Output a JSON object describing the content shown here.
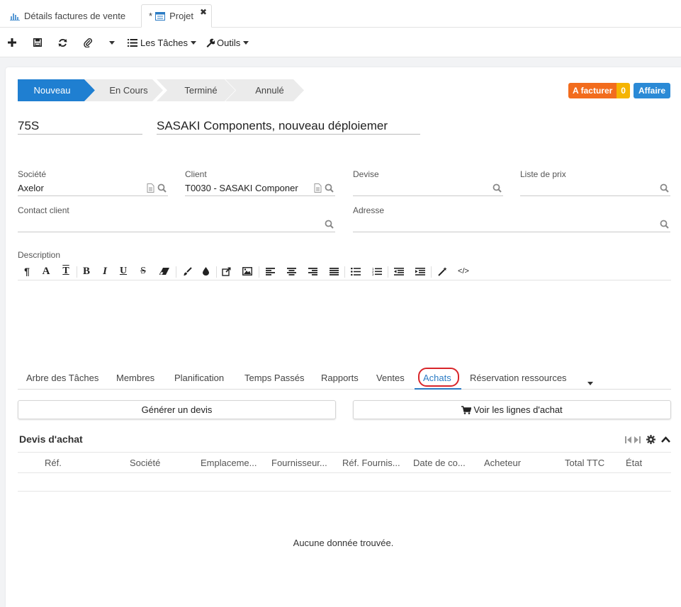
{
  "tabs": [
    {
      "label": "Détails factures de vente"
    },
    {
      "label": "* Projet",
      "close": "×"
    }
  ],
  "toolbar": {
    "tasks_label": "Les Tâches",
    "tools_label": "Outils"
  },
  "status_steps": [
    {
      "label": "Nouveau",
      "active": true
    },
    {
      "label": "En Cours",
      "active": false
    },
    {
      "label": "Terminé",
      "active": false
    },
    {
      "label": "Annulé",
      "active": false
    }
  ],
  "badges": {
    "invoice_label": "A facturer",
    "invoice_count": "0",
    "business_label": "Affaire"
  },
  "header": {
    "code": "75S",
    "name": "SASAKI Components, nouveau déploiemer"
  },
  "fields": {
    "company_label": "Société",
    "company_value": "Axelor",
    "client_label": "Client",
    "client_value": "T0030 - SASAKI Componer",
    "currency_label": "Devise",
    "currency_value": "",
    "pricelist_label": "Liste de prix",
    "pricelist_value": "",
    "contact_label": "Contact client",
    "contact_value": "",
    "address_label": "Adresse",
    "address_value": "",
    "description_label": "Description"
  },
  "lower_tabs": [
    {
      "label": "Arbre des Tâches"
    },
    {
      "label": "Membres"
    },
    {
      "label": "Planification"
    },
    {
      "label": "Temps Passés"
    },
    {
      "label": "Rapports"
    },
    {
      "label": "Ventes"
    },
    {
      "label": "Achats",
      "active": true
    },
    {
      "label": "Réservation ressources"
    }
  ],
  "actions": {
    "generate_quote": "Générer un devis",
    "view_purchase_lines": "Voir les lignes d'achat"
  },
  "grid": {
    "title": "Devis d'achat",
    "columns": [
      "Réf.",
      "Société",
      "Emplaceme...",
      "Fournisseur...",
      "Réf. Fournis...",
      "Date de co...",
      "Acheteur",
      "Total TTC",
      "État"
    ],
    "empty_message": "Aucune donnée trouvée."
  },
  "colors": {
    "accent": "#2b7bc4",
    "active_step": "#1f7fd1",
    "badge_orange": "#f26c1d",
    "badge_yellow": "#f5b400",
    "badge_blue": "#2b8ad6",
    "highlight": "#d8252a"
  }
}
